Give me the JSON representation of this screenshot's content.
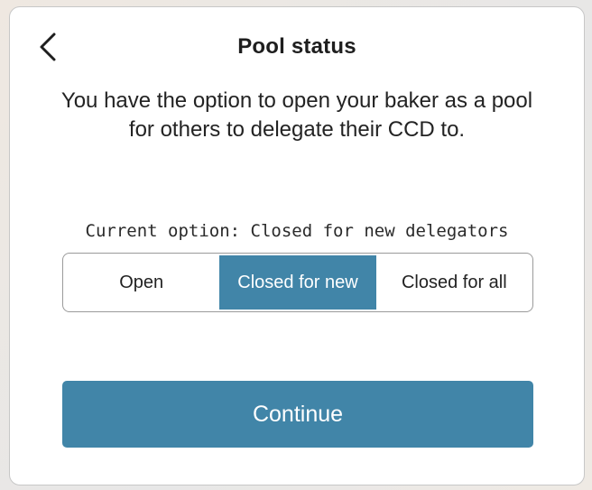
{
  "header": {
    "back_icon": "chevron-left-icon",
    "title": "Pool status"
  },
  "description": "You have the option to open your baker as a pool for others to delegate their CCD to.",
  "current_option": "Current option: Closed for new delegators",
  "pool_options": [
    {
      "label": "Open",
      "selected": false
    },
    {
      "label": "Closed for new",
      "selected": true
    },
    {
      "label": "Closed for all",
      "selected": false
    }
  ],
  "continue_label": "Continue",
  "colors": {
    "accent": "#4185a8",
    "card_bg": "#ffffff",
    "text": "#232323"
  }
}
